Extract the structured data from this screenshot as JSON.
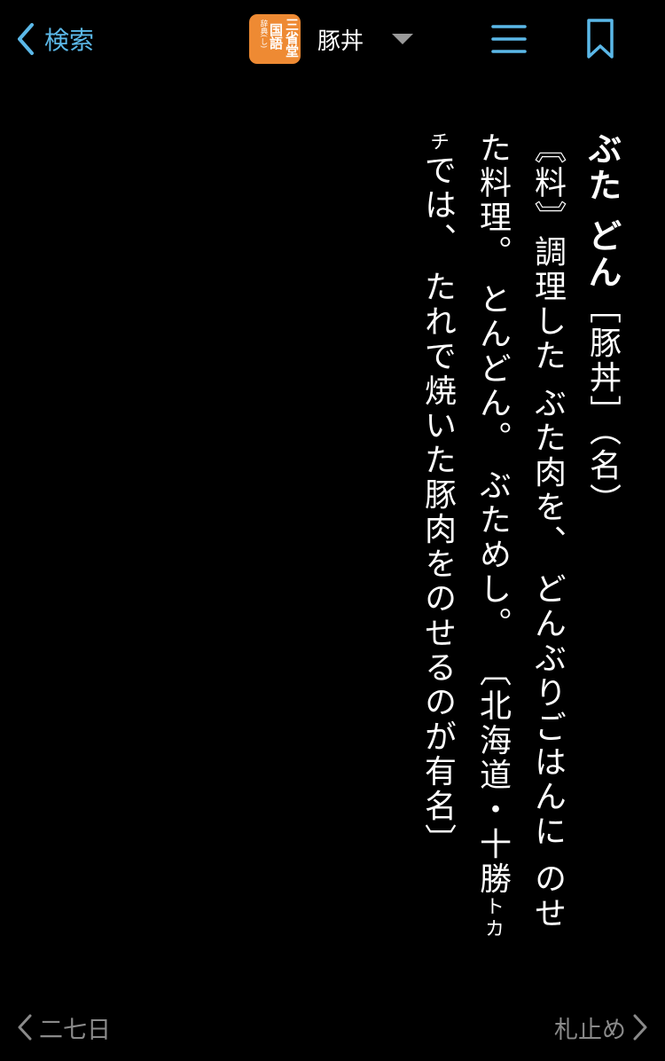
{
  "nav": {
    "back_label": "検索",
    "headword": "豚丼",
    "colors": {
      "accent": "#5BB8E8",
      "logo": "#EE8A33"
    }
  },
  "dictionary_logo": {
    "line1": "三省堂",
    "line2": "国語",
    "line3": "辞典(し)"
  },
  "entry": {
    "reading": "ぶた どん",
    "kanji": "［豚丼］",
    "pos": "（名）",
    "domain_tag": "〘料〙",
    "definition": "調理した ぶた肉を、 どんぶりごはんに のせた料理。 とんどん。 ぶためし。 〔北海道・十勝",
    "ruby": "トカチ",
    "note": "では、 たれで焼いた豚肉をのせるのが有名〕"
  },
  "footer": {
    "prev_label": "二七日",
    "next_label": "札止め"
  }
}
